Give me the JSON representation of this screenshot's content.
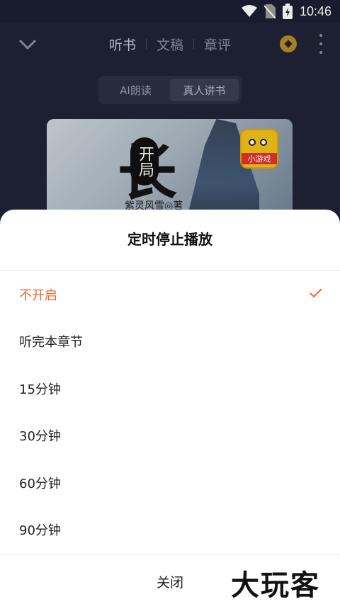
{
  "status_bar": {
    "time": "10:46"
  },
  "top_bar": {
    "tabs": [
      {
        "label": "听书"
      },
      {
        "label": "文稿"
      },
      {
        "label": "章评"
      }
    ]
  },
  "mode_toggle": {
    "options": [
      {
        "label": "AI朗读"
      },
      {
        "label": "真人讲书"
      }
    ],
    "selected": "真人讲书"
  },
  "cover": {
    "title_glyph": "长",
    "badge_text": "开局",
    "author": "紫灵风雪◎著",
    "game_badge_label": "小游戏"
  },
  "sheet": {
    "title": "定时停止播放",
    "options": [
      {
        "label": "不开启"
      },
      {
        "label": "听完本章节"
      },
      {
        "label": "15分钟"
      },
      {
        "label": "30分钟"
      },
      {
        "label": "60分钟"
      },
      {
        "label": "90分钟"
      }
    ],
    "selected": "不开启",
    "close_label": "关闭"
  },
  "watermark": "大玩客",
  "colors": {
    "accent": "#f2652d",
    "background": "#1f2336",
    "sheet": "#ffffff"
  }
}
